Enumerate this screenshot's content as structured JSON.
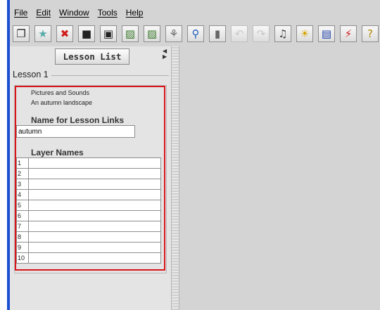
{
  "menu": [
    {
      "label": "File"
    },
    {
      "label": "Edit"
    },
    {
      "label": "Window"
    },
    {
      "label": "Tools"
    },
    {
      "label": "Help"
    }
  ],
  "toolbar": [
    {
      "icon": "new-document-icon",
      "glyph": "❐",
      "enabled": true,
      "color": "#222"
    },
    {
      "icon": "open-folder-icon",
      "glyph": "★",
      "enabled": true,
      "color": "#5aa"
    },
    {
      "icon": "delete-icon",
      "glyph": "✖",
      "enabled": true,
      "color": "#d01e1e"
    },
    {
      "icon": "save-icon",
      "glyph": "■",
      "enabled": true,
      "color": "#222"
    },
    {
      "icon": "save-all-icon",
      "glyph": "▣",
      "enabled": true,
      "color": "#222"
    },
    {
      "icon": "book-add-icon",
      "glyph": "▨",
      "enabled": true,
      "color": "#3a7a2a"
    },
    {
      "icon": "book-icon",
      "glyph": "▨",
      "enabled": true,
      "color": "#3a7a2a"
    },
    {
      "icon": "tree-icon",
      "glyph": "⚘",
      "enabled": true,
      "color": "#666"
    },
    {
      "icon": "search-icon",
      "glyph": "⚲",
      "enabled": true,
      "color": "#1e5fbf"
    },
    {
      "icon": "eraser-icon",
      "glyph": "▮",
      "enabled": true,
      "color": "#666"
    },
    {
      "icon": "undo-icon",
      "glyph": "↶",
      "enabled": false,
      "color": "#c8c8c8"
    },
    {
      "icon": "redo-icon",
      "glyph": "↷",
      "enabled": false,
      "color": "#c8c8c8"
    },
    {
      "icon": "sound-icon",
      "glyph": "♫",
      "enabled": true,
      "color": "#444"
    },
    {
      "icon": "lightbulb-icon",
      "glyph": "☀",
      "enabled": true,
      "color": "#d6a400"
    },
    {
      "icon": "image-icon",
      "glyph": "▤",
      "enabled": true,
      "color": "#1d3fa8"
    },
    {
      "icon": "flash-icon",
      "glyph": "⚡",
      "enabled": true,
      "color": "#d01e1e"
    },
    {
      "icon": "help-icon",
      "glyph": "?",
      "enabled": true,
      "color": "#b08a00"
    }
  ],
  "left_panel": {
    "lesson_list_label": "Lesson List",
    "lesson_title": "Lesson 1",
    "lesson_descriptions": [
      "Pictures and Sounds",
      "An autumn landscape"
    ],
    "links_heading": "Name for Lesson Links",
    "link_name_value": "autumn",
    "layers_heading": "Layer Names",
    "layers": [
      {
        "number": "1",
        "name": ""
      },
      {
        "number": "2",
        "name": ""
      },
      {
        "number": "3",
        "name": ""
      },
      {
        "number": "4",
        "name": ""
      },
      {
        "number": "5",
        "name": ""
      },
      {
        "number": "6",
        "name": ""
      },
      {
        "number": "7",
        "name": ""
      },
      {
        "number": "8",
        "name": ""
      },
      {
        "number": "9",
        "name": ""
      },
      {
        "number": "10",
        "name": ""
      }
    ]
  },
  "colors": {
    "accent_blue": "#1a4fd1",
    "highlight_red": "#d9161b",
    "panel_bg": "#e4e4e4",
    "workspace_bg": "#d4d4d4"
  }
}
